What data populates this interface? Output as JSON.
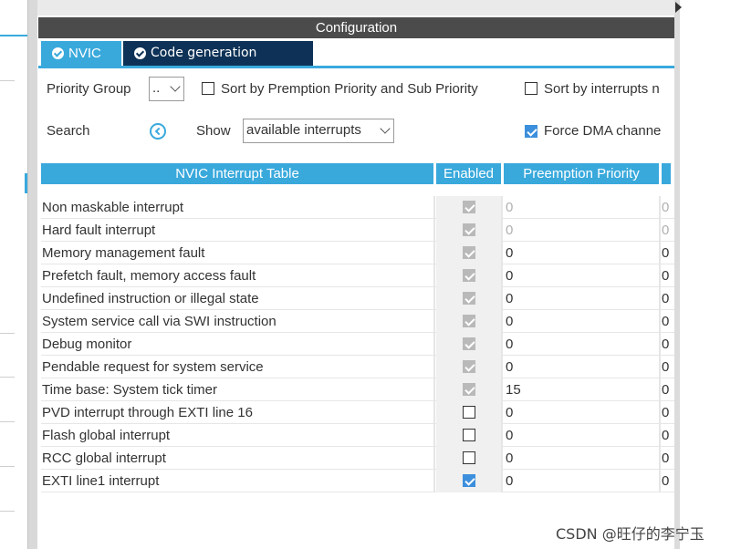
{
  "panel": {
    "title": "Configuration"
  },
  "tabs": [
    {
      "label": "NVIC",
      "active": true
    },
    {
      "label": "Code generation",
      "active": false
    }
  ],
  "options": {
    "priority_group_label": "Priority Group",
    "priority_group_value": "..",
    "sort_premption_label": "Sort by Premption Priority and Sub Priority",
    "sort_premption_checked": false,
    "sort_interrupts_label": "Sort by interrupts n",
    "sort_interrupts_checked": false,
    "search_label": "Search",
    "show_label": "Show",
    "show_value": "available interrupts",
    "force_dma_label": "Force DMA channe",
    "force_dma_checked": true
  },
  "table": {
    "headers": [
      "NVIC Interrupt Table",
      "Enabled",
      "Preemption Priority"
    ],
    "rows": [
      {
        "name": "Non maskable interrupt",
        "enabled": "locked",
        "preemption": "0",
        "sub": "0",
        "dim": true
      },
      {
        "name": "Hard fault interrupt",
        "enabled": "locked",
        "preemption": "0",
        "sub": "0",
        "dim": true
      },
      {
        "name": "Memory management fault",
        "enabled": "locked",
        "preemption": "0",
        "sub": "0",
        "dim": false
      },
      {
        "name": "Prefetch fault, memory access fault",
        "enabled": "locked",
        "preemption": "0",
        "sub": "0",
        "dim": false
      },
      {
        "name": "Undefined instruction or illegal state",
        "enabled": "locked",
        "preemption": "0",
        "sub": "0",
        "dim": false
      },
      {
        "name": "System service call via SWI instruction",
        "enabled": "locked",
        "preemption": "0",
        "sub": "0",
        "dim": false
      },
      {
        "name": "Debug monitor",
        "enabled": "locked",
        "preemption": "0",
        "sub": "0",
        "dim": false
      },
      {
        "name": "Pendable request for system service",
        "enabled": "locked",
        "preemption": "0",
        "sub": "0",
        "dim": false
      },
      {
        "name": "Time base: System tick timer",
        "enabled": "locked",
        "preemption": "15",
        "sub": "0",
        "dim": false
      },
      {
        "name": "PVD interrupt through EXTI line 16",
        "enabled": "off",
        "preemption": "0",
        "sub": "0",
        "dim": false
      },
      {
        "name": "Flash global interrupt",
        "enabled": "off",
        "preemption": "0",
        "sub": "0",
        "dim": false
      },
      {
        "name": "RCC global interrupt",
        "enabled": "off",
        "preemption": "0",
        "sub": "0",
        "dim": false
      },
      {
        "name": "EXTI line1 interrupt",
        "enabled": "on",
        "preemption": "0",
        "sub": "0",
        "dim": false
      }
    ]
  },
  "watermark": "CSDN @旺仔的李宁玉",
  "colors": {
    "accent": "#39a9dc",
    "dark_tab": "#0e3257",
    "header_bar": "#4b4b4b",
    "checkbox_blue": "#3c8fdc",
    "checkbox_locked": "#b9b9b9"
  }
}
